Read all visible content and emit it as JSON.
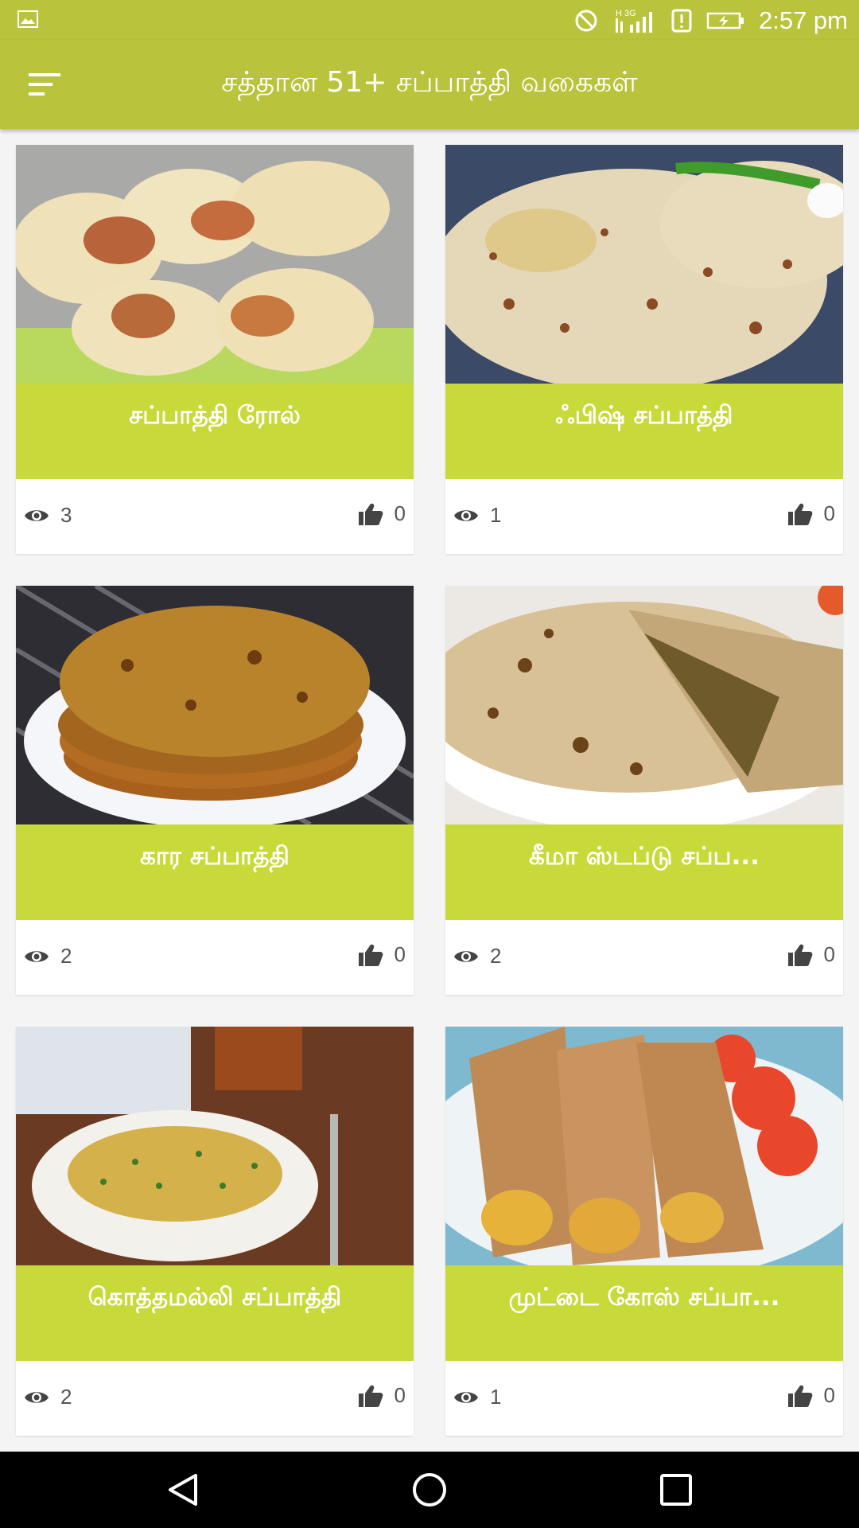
{
  "status_bar": {
    "time": "2:57 pm",
    "icons": [
      "image-icon",
      "do-not-disturb-icon",
      "network-h-3g-icon",
      "signal-icon",
      "alert-icon",
      "battery-charging-icon"
    ]
  },
  "app_bar": {
    "title": "சத்தான 51+ சப்பாத்தி வகைகள்",
    "menu_icon": "menu-sort-icon"
  },
  "colors": {
    "app_bar": "#b9c43c",
    "card_label": "#c8d93a",
    "icon": "#444444"
  },
  "cards": [
    {
      "title": "சப்பாத்தி ரோல்",
      "views": "3",
      "likes": "0"
    },
    {
      "title": "ஃபிஷ் சப்பாத்தி",
      "views": "1",
      "likes": "0"
    },
    {
      "title": "கார சப்பாத்தி",
      "views": "2",
      "likes": "0"
    },
    {
      "title": "கீமா ஸ்டப்டு சப்ப...",
      "views": "2",
      "likes": "0"
    },
    {
      "title": "கொத்தமல்லி சப்பாத்தி",
      "views": "2",
      "likes": "0"
    },
    {
      "title": "முட்டை கோஸ் சப்பா...",
      "views": "1",
      "likes": "0"
    }
  ],
  "nav_bar": {
    "back": "back-icon",
    "home": "home-icon",
    "recents": "recents-icon"
  }
}
